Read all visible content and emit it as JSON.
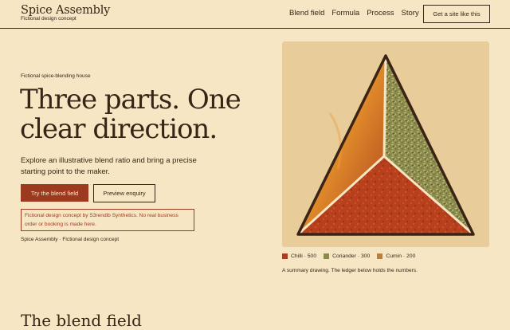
{
  "brand": {
    "title": "Spice Assembly",
    "tagline": "Fictional design concept"
  },
  "nav": {
    "items": [
      "Blend field",
      "Formula",
      "Process",
      "Story"
    ],
    "cta_label": "Get a site like this"
  },
  "hero": {
    "eyebrow": "Fictional spice-blending house",
    "headline": "Three parts. One clear direction.",
    "lede": "Explore an illustrative blend ratio and bring a precise starting point to the maker.",
    "primary_button": "Try the blend field",
    "secondary_button": "Preview enquiry",
    "disclaimer": "Fictional design concept by S3rendib Synthetics. No real business order or booking is made here.",
    "footnote": "Spice Assembly · Fictional design concept"
  },
  "legend": [
    {
      "label": "Chilli · 500",
      "color": "#a8401f"
    },
    {
      "label": "Coriander · 300",
      "color": "#8a8a4a"
    },
    {
      "label": "Cumin · 200",
      "color": "#b8803a"
    }
  ],
  "caption": "A summary drawing. The ledger below holds the numbers.",
  "next_section": {
    "heading": "The blend field"
  },
  "colors": {
    "background": "#f7e6c4",
    "ink": "#3a2417",
    "accent": "#9b3a1f",
    "panel": "#e8cc9a"
  }
}
